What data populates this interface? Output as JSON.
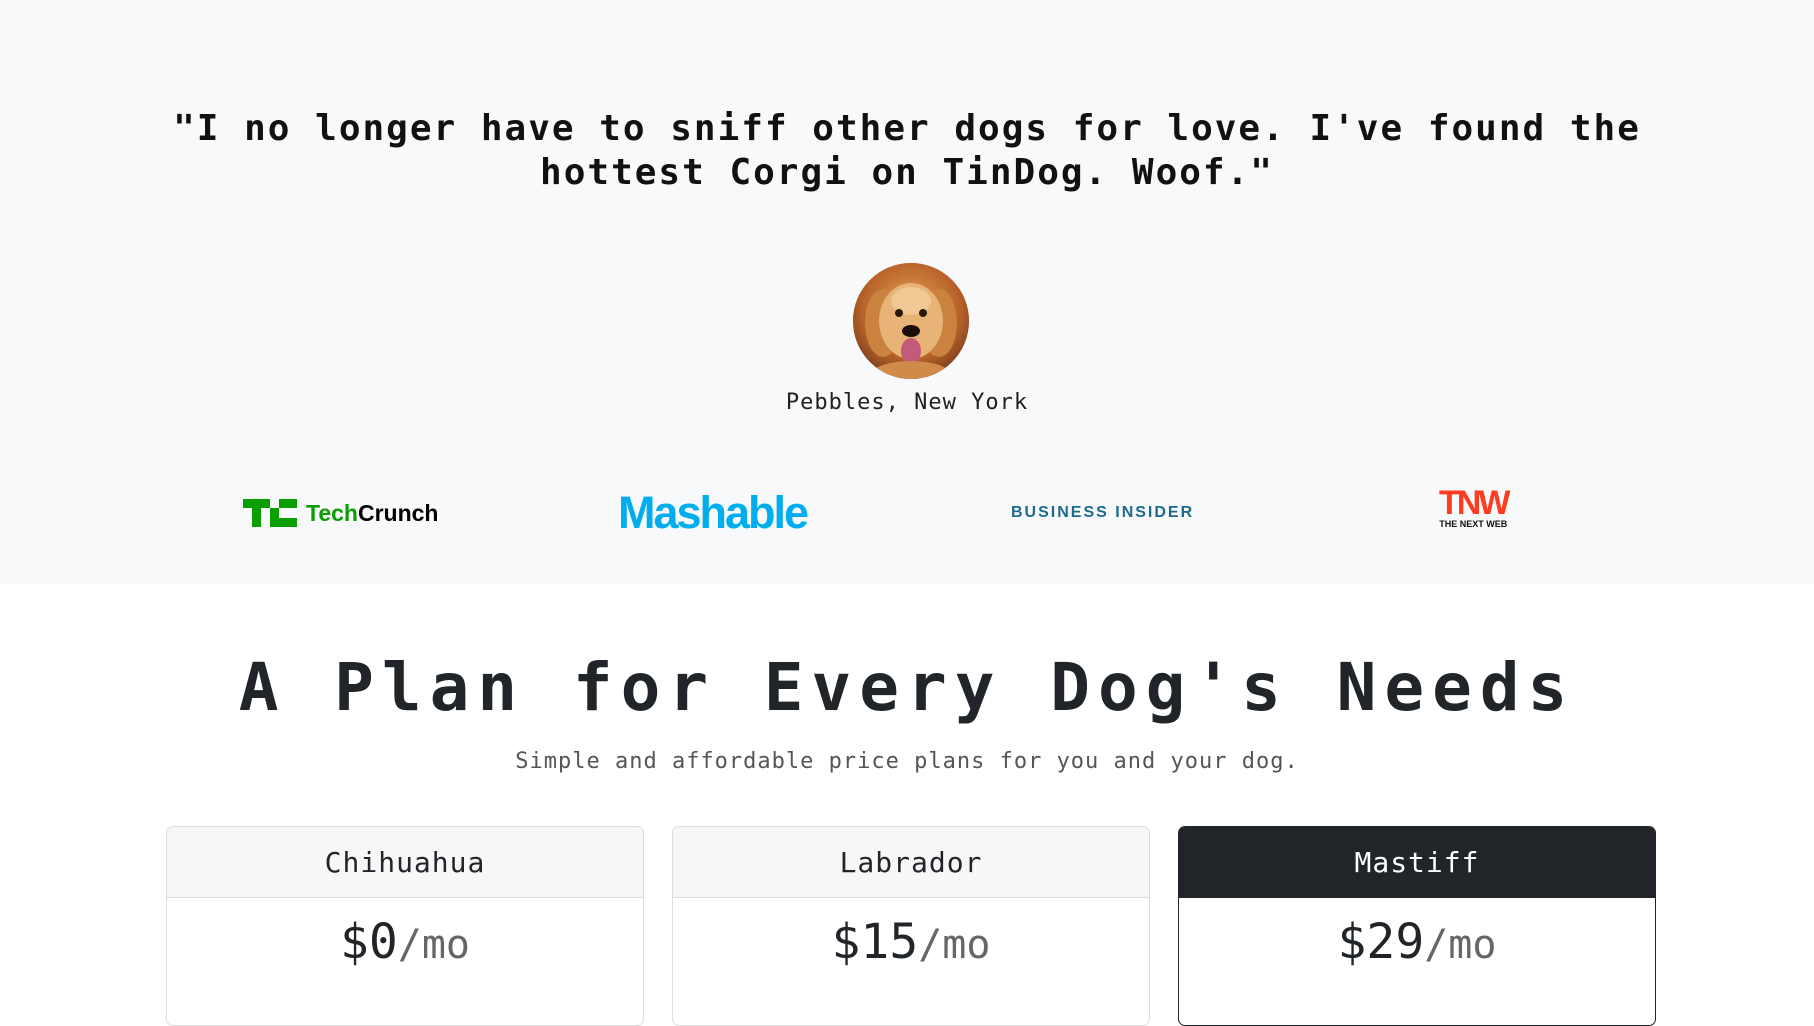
{
  "testimonial": {
    "quote_line1": "\"I no longer have to sniff other dogs for love. I've found the",
    "quote_line2": "hottest Corgi on TinDog. Woof.\"",
    "author": "Pebbles, New York"
  },
  "press": {
    "techcrunch_tech": "Tech",
    "techcrunch_crunch": "Crunch",
    "mashable": "Mashable",
    "business_insider": "BUSINESS INSIDER",
    "tnw": "TNW",
    "tnw_sub": "THE NEXT WEB"
  },
  "pricing": {
    "title": "A Plan for Every Dog's Needs",
    "subtitle": "Simple and affordable price plans for you and your dog.",
    "plans": [
      {
        "name": "Chihuahua",
        "price": "$0",
        "period": "/mo"
      },
      {
        "name": "Labrador",
        "price": "$15",
        "period": "/mo"
      },
      {
        "name": "Mastiff",
        "price": "$29",
        "period": "/mo"
      }
    ]
  },
  "colors": {
    "section_bg": "#f8f9fa",
    "dark": "#212529",
    "techcrunch_green": "#0a9e01",
    "mashable_blue": "#00aeef",
    "business_insider_blue": "#1c6a8c",
    "tnw_red": "#ff3c1f"
  }
}
